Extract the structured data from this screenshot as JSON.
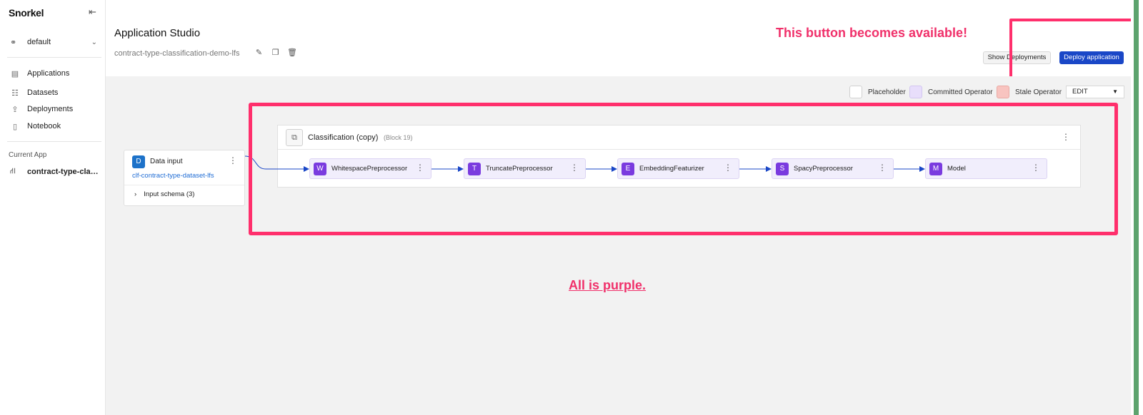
{
  "sidebar": {
    "logo": "Snorkel",
    "collapse_icon": "collapse-left-icon",
    "workspace": {
      "label": "default",
      "icon": "workspace-icon"
    },
    "nav": [
      {
        "label": "Applications",
        "icon": "applications-icon"
      },
      {
        "label": "Datasets",
        "icon": "datasets-icon"
      },
      {
        "label": "Deployments",
        "icon": "deployments-icon"
      },
      {
        "label": "Notebook",
        "icon": "notebook-icon"
      }
    ],
    "current_app_title": "Current App",
    "current_app": "contract-type-classi..."
  },
  "header": {
    "title": "Application Studio",
    "app_name": "contract-type-classification-demo-lfs",
    "show_deployments": "Show Deployments",
    "deploy_application": "Deploy application"
  },
  "annotations": {
    "top": "This button becomes available!",
    "middle": "All is purple."
  },
  "legend": {
    "placeholder": "Placeholder",
    "committed": "Committed Operator",
    "stale": "Stale Operator",
    "mode": "EDIT",
    "colors": {
      "placeholder": "#ffffff",
      "committed": "#e8defb",
      "stale": "#f8c4c0"
    }
  },
  "data_input": {
    "badge": "D",
    "title": "Data input",
    "dataset": "clf-contract-type-dataset-lfs",
    "schema": "Input schema (3)"
  },
  "block": {
    "title": "Classification (copy)",
    "subtitle": "(Block 19)",
    "operators": [
      {
        "badge": "W",
        "name": "WhitespacePreprocessor"
      },
      {
        "badge": "T",
        "name": "TruncatePreprocessor"
      },
      {
        "badge": "E",
        "name": "EmbeddingFeaturizer"
      },
      {
        "badge": "S",
        "name": "SpacyPreprocessor"
      },
      {
        "badge": "M",
        "name": "Model"
      }
    ]
  },
  "colors": {
    "accent": "#1a47c7",
    "operator": "#7a3bdf",
    "highlight": "#ff2f6c"
  }
}
